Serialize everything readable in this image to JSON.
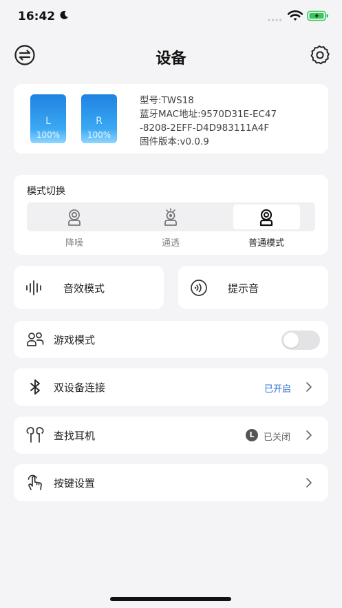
{
  "status": {
    "time": "16:42",
    "battery_color": "#34c759"
  },
  "nav": {
    "title": "设备",
    "left_icon": "swap-icon",
    "right_icon": "gear-icon"
  },
  "device": {
    "left_bud": {
      "letter": "L",
      "battery": "100%",
      "battery_level": 1.0
    },
    "right_bud": {
      "letter": "R",
      "battery": "100%",
      "battery_level": 1.0
    },
    "model": "型号:TWS18",
    "mac_line1": "蓝牙MAC地址:9570D31E-EC47",
    "mac_line2": "-8208-2EFF-D4D983111A4F",
    "firmware": "固件版本:v0.0.9",
    "accent": "#2d8ee8"
  },
  "mode_switch": {
    "title": "模式切换",
    "options": [
      {
        "label": "降噪",
        "icon": "noise-cancel-icon"
      },
      {
        "label": "通透",
        "icon": "transparency-icon"
      },
      {
        "label": "普通模式",
        "icon": "normal-mode-icon"
      }
    ],
    "selected": "普通模式"
  },
  "sound_effect": {
    "label": "音效模式",
    "icon": "waveform-icon"
  },
  "prompt_tone": {
    "label": "提示音",
    "icon": "sound-wave-icon"
  },
  "game_mode": {
    "label": "游戏模式",
    "icon": "game-icon",
    "enabled": false
  },
  "dual_device": {
    "label": "双设备连接",
    "icon": "bluetooth-icon",
    "status": "已开启",
    "status_color": "#2a6fd0"
  },
  "find_earphone": {
    "label": "查找耳机",
    "icon": "earbuds-icon",
    "badge": "L",
    "status": "已关闭"
  },
  "key_settings": {
    "label": "按键设置",
    "icon": "tap-icon"
  }
}
